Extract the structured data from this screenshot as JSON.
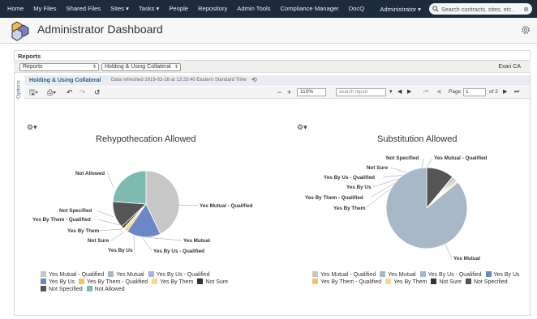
{
  "nav": {
    "items": [
      "Home",
      "My Files",
      "Shared Files",
      "Sites ▾",
      "Tasks ▾",
      "People",
      "Repository",
      "Admin Tools",
      "Compliance Manager",
      "DocQ"
    ],
    "user": "Administrator ▾",
    "search_placeholder": "Search contracts, sites, etc."
  },
  "header": {
    "title": "Administrator Dashboard"
  },
  "reports": {
    "label": "Reports",
    "select1": "Reports",
    "select2": "Holding & Using Collateral",
    "org": "Exari CA",
    "options_tab": "Options",
    "report_name": "Holding & Using Collateral",
    "refreshed": "Data refreshed 2019-02-28 at 13:23:40 Eastern Standard Time",
    "zoom": "110%",
    "search_placeholder": "search report",
    "page_label": "Page",
    "page_value": "1",
    "page_of": "of 2"
  },
  "colors": {
    "nav_bg": "#1e2b3c",
    "yes_mutual_qualified": "#c7c7c7",
    "yes_mutual": "#a9b8c6",
    "yes_by_us_qualified": "#a4b4dc",
    "yes_by_us": "#6b87c8",
    "yes_by_them_qualified": "#f2c45c",
    "yes_by_them": "#f6dc8a",
    "not_sure": "#333333",
    "not_specified": "#555555",
    "not_allowed": "#7dbab1"
  },
  "chart_data": [
    {
      "type": "pie",
      "title": "Rehypothecation Allowed",
      "categories": [
        "Yes Mutual - Qualified",
        "Yes Mutual",
        "Yes By Us - Qualified",
        "Yes By Us",
        "Yes By Them - Qualified",
        "Yes By Them",
        "Not Sure",
        "Not Specified",
        "Not Allowed"
      ],
      "values": [
        36,
        0,
        0,
        14,
        1,
        1,
        1,
        11,
        20
      ],
      "legend": [
        "Yes Mutual - Qualified",
        "Yes Mutual",
        "Yes By Us - Qualified",
        "Yes By Us",
        "Yes By Them - Qualified",
        "Yes By Them",
        "Not Sure",
        "Not Specified",
        "Not Allowed"
      ]
    },
    {
      "type": "pie",
      "title": "Substitution Allowed",
      "categories": [
        "Not Specified",
        "Yes Mutual - Qualified",
        "Not Sure",
        "Yes By Us - Qualified",
        "Yes By Us",
        "Yes By Them - Qualified",
        "Yes By Them",
        "Yes Mutual"
      ],
      "values": [
        11,
        0.5,
        0.5,
        0.5,
        0.5,
        0.5,
        0.5,
        86
      ],
      "legend": [
        "Yes Mutual - Qualified",
        "Yes Mutual",
        "Yes By Us - Qualified",
        "Yes By Us",
        "Yes By Them - Qualified",
        "Yes By Them",
        "Not Sure",
        "Not Specified"
      ]
    }
  ]
}
